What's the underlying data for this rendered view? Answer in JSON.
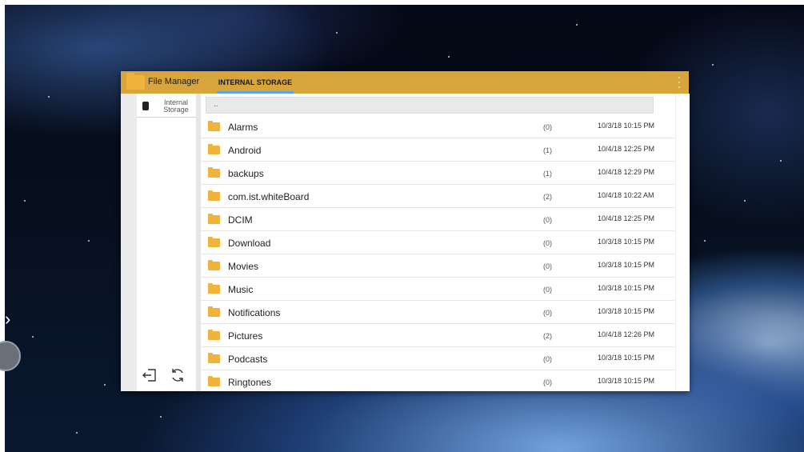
{
  "app": {
    "title": "File Manager",
    "active_tab": "INTERNAL STORAGE",
    "menu_icon": "overflow-menu-icon",
    "accent_color": "#d7a53b",
    "tab_underline_color": "#5aa6e0"
  },
  "sidebar": {
    "storage_label": "Internal Storage",
    "storage_icon": "sd-card-icon",
    "exit_icon": "exit-icon",
    "refresh_icon": "refresh-icon"
  },
  "path_bar": {
    "text": ".."
  },
  "files": [
    {
      "name": "Alarms",
      "count": "(0)",
      "date": "10/3/18 10:15 PM"
    },
    {
      "name": "Android",
      "count": "(1)",
      "date": "10/4/18 12:25 PM"
    },
    {
      "name": "backups",
      "count": "(1)",
      "date": "10/4/18 12:29 PM"
    },
    {
      "name": "com.ist.whiteBoard",
      "count": "(2)",
      "date": "10/4/18 10:22 AM"
    },
    {
      "name": "DCIM",
      "count": "(0)",
      "date": "10/4/18 12:25 PM"
    },
    {
      "name": "Download",
      "count": "(0)",
      "date": "10/3/18 10:15 PM"
    },
    {
      "name": "Movies",
      "count": "(0)",
      "date": "10/3/18 10:15 PM"
    },
    {
      "name": "Music",
      "count": "(0)",
      "date": "10/3/18 10:15 PM"
    },
    {
      "name": "Notifications",
      "count": "(0)",
      "date": "10/3/18 10:15 PM"
    },
    {
      "name": "Pictures",
      "count": "(2)",
      "date": "10/4/18 12:26 PM"
    },
    {
      "name": "Podcasts",
      "count": "(0)",
      "date": "10/3/18 10:15 PM"
    },
    {
      "name": "Ringtones",
      "count": "(0)",
      "date": "10/3/18 10:15 PM"
    }
  ]
}
